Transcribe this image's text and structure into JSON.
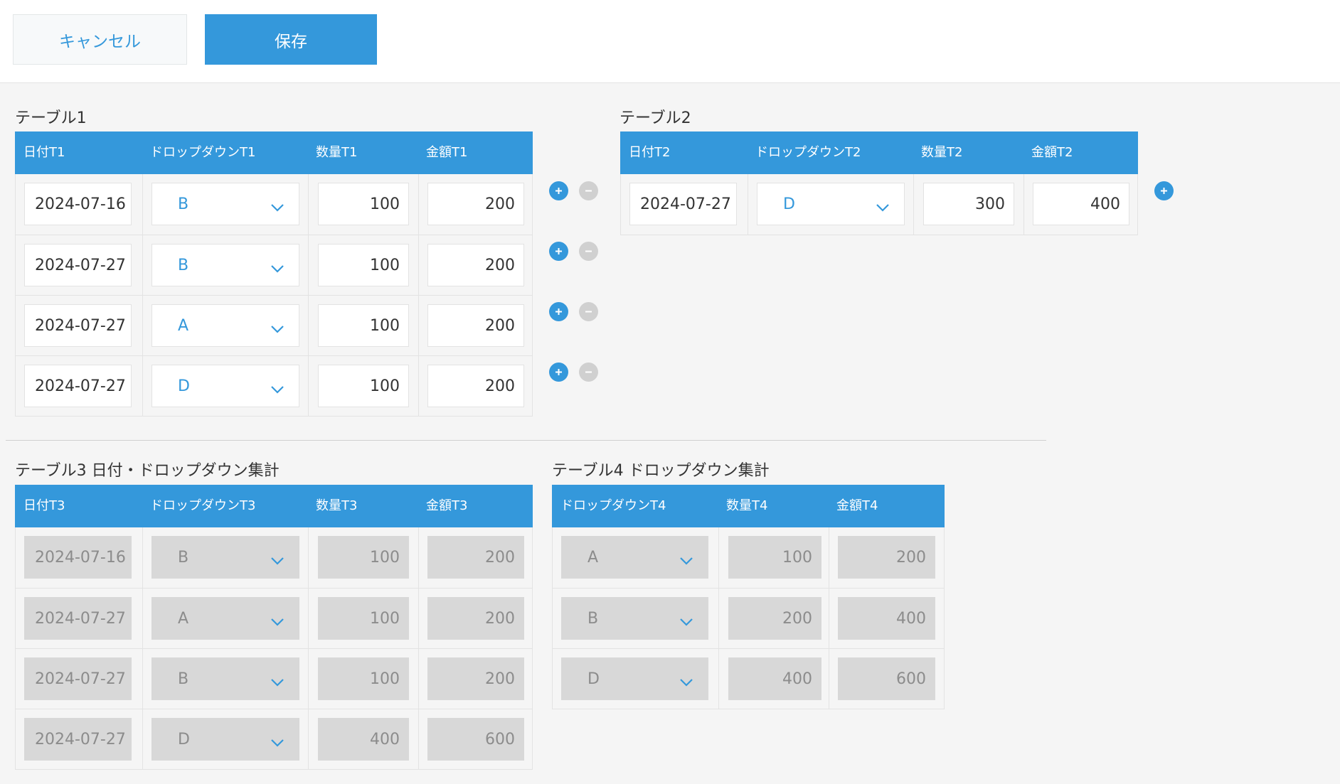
{
  "header": {
    "cancel_label": "キャンセル",
    "save_label": "保存"
  },
  "table1": {
    "title": "テーブル1",
    "headers": [
      "日付T1",
      "ドロップダウンT1",
      "数量T1",
      "金額T1"
    ],
    "rows": [
      {
        "date": "2024-07-16",
        "option": "B",
        "qty": "100",
        "amount": "200"
      },
      {
        "date": "2024-07-27",
        "option": "B",
        "qty": "100",
        "amount": "200"
      },
      {
        "date": "2024-07-27",
        "option": "A",
        "qty": "100",
        "amount": "200"
      },
      {
        "date": "2024-07-27",
        "option": "D",
        "qty": "100",
        "amount": "200"
      }
    ]
  },
  "table2": {
    "title": "テーブル2",
    "headers": [
      "日付T2",
      "ドロップダウンT2",
      "数量T2",
      "金額T2"
    ],
    "rows": [
      {
        "date": "2024-07-27",
        "option": "D",
        "qty": "300",
        "amount": "400"
      }
    ]
  },
  "table3": {
    "title": "テーブル3 日付・ドロップダウン集計",
    "headers": [
      "日付T3",
      "ドロップダウンT3",
      "数量T3",
      "金額T3"
    ],
    "rows": [
      {
        "date": "2024-07-16",
        "option": "B",
        "qty": "100",
        "amount": "200"
      },
      {
        "date": "2024-07-27",
        "option": "A",
        "qty": "100",
        "amount": "200"
      },
      {
        "date": "2024-07-27",
        "option": "B",
        "qty": "100",
        "amount": "200"
      },
      {
        "date": "2024-07-27",
        "option": "D",
        "qty": "400",
        "amount": "600"
      }
    ]
  },
  "table4": {
    "title": "テーブル4 ドロップダウン集計",
    "headers": [
      "ドロップダウンT4",
      "数量T4",
      "金額T4"
    ],
    "rows": [
      {
        "option": "A",
        "qty": "100",
        "amount": "200"
      },
      {
        "option": "B",
        "qty": "200",
        "amount": "400"
      },
      {
        "option": "D",
        "qty": "400",
        "amount": "600"
      }
    ]
  },
  "colors": {
    "accent": "#3498db",
    "readonly_bg": "#d8d8d8",
    "minus_bg": "#d0d0d0"
  },
  "icons": {
    "dropdown": "chevron-down-icon",
    "add_row": "plus-icon",
    "remove_row": "minus-icon"
  }
}
